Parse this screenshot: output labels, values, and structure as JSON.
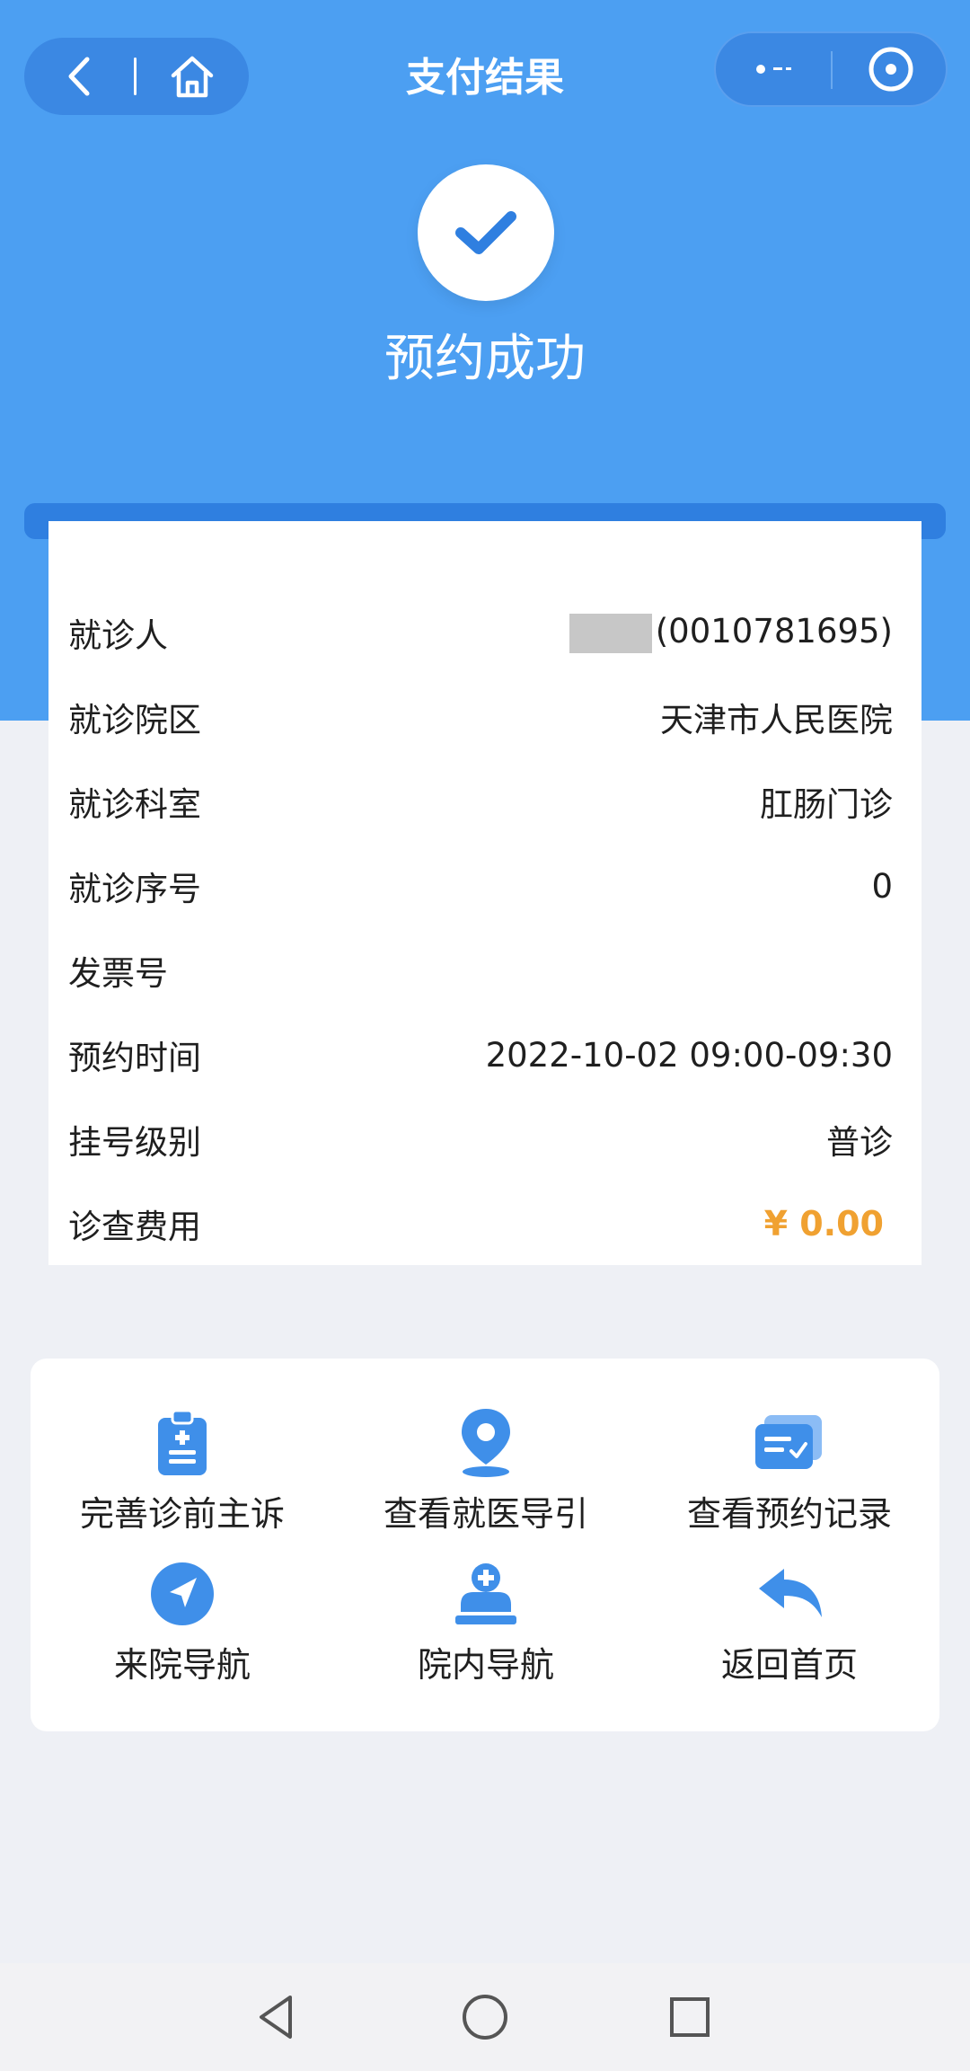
{
  "header": {
    "title": "支付结果",
    "back_icon": "chevron-left-icon",
    "home_icon": "home-icon",
    "menu_icon": "more-dots-icon",
    "close_icon": "close-target-icon"
  },
  "status": {
    "icon": "check-icon",
    "title": "预约成功"
  },
  "info": {
    "rows": [
      {
        "label": "就诊人",
        "value": "(0010781695)"
      },
      {
        "label": "就诊院区",
        "value": "天津市人民医院"
      },
      {
        "label": "就诊科室",
        "value": "肛肠门诊"
      },
      {
        "label": "就诊序号",
        "value": "0"
      },
      {
        "label": "发票号",
        "value": ""
      },
      {
        "label": "预约时间",
        "value": "2022-10-02 09:00-09:30"
      },
      {
        "label": "挂号级别",
        "value": "普诊"
      },
      {
        "label": "诊查费用",
        "value": "¥ 0.00"
      }
    ]
  },
  "actions": [
    {
      "label": "完善诊前主诉",
      "icon": "clipboard-icon"
    },
    {
      "label": "查看就医导引",
      "icon": "location-pin-icon"
    },
    {
      "label": "查看预约记录",
      "icon": "records-icon"
    },
    {
      "label": "来院导航",
      "icon": "navigation-icon"
    },
    {
      "label": "院内导航",
      "icon": "hospital-icon"
    },
    {
      "label": "返回首页",
      "icon": "return-icon"
    }
  ],
  "system_nav": {
    "back": "triangle-back-icon",
    "home": "circle-home-icon",
    "recents": "square-recents-icon"
  },
  "colors": {
    "primary": "#4c9ff2",
    "icon_blue": "#3f8fe9",
    "fee": "#f0a131"
  }
}
